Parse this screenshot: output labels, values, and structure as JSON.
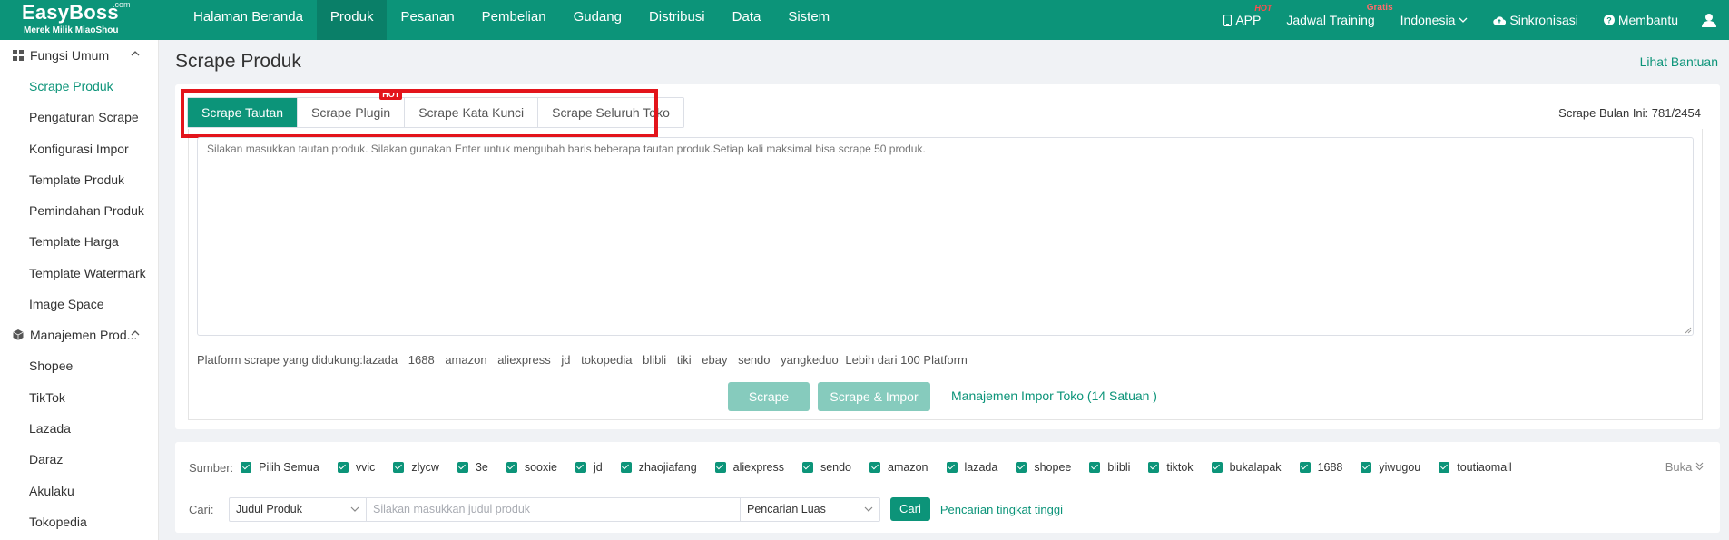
{
  "logo": {
    "brand": "EasyBoss",
    "com": ".com",
    "sub": "Merek Milik MiaoShou"
  },
  "nav": {
    "items": [
      "Halaman Beranda",
      "Produk",
      "Pesanan",
      "Pembelian",
      "Gudang",
      "Distribusi",
      "Data",
      "Sistem"
    ],
    "active": "Produk"
  },
  "tools": {
    "app": "APP",
    "app_badge": "HOT",
    "training": "Jadwal Training",
    "training_badge": "Gratis",
    "language": "Indonesia",
    "sync": "Sinkronisasi",
    "help": "Membantu"
  },
  "sidebar": {
    "group1": "Fungsi Umum",
    "group1_items": [
      "Scrape Produk",
      "Pengaturan Scrape",
      "Konfigurasi Impor",
      "Template Produk",
      "Pemindahan Produk",
      "Template Harga",
      "Template Watermark",
      "Image Space"
    ],
    "group2": "Manajemen Prod...",
    "group2_items": [
      "Shopee",
      "TikTok",
      "Lazada",
      "Daraz",
      "Akulaku",
      "Tokopedia"
    ]
  },
  "page": {
    "title": "Scrape Produk",
    "help_link": "Lihat Bantuan"
  },
  "tabs": {
    "items": [
      "Scrape Tautan",
      "Scrape Plugin",
      "Scrape Kata Kunci",
      "Scrape Seluruh Toko"
    ],
    "hot_badge": "HOT"
  },
  "scrape_count": "Scrape Bulan Ini:  781/2454",
  "textarea_placeholder": "Silakan masukkan tautan produk. Silakan gunakan Enter untuk mengubah baris beberapa tautan produk.Setiap kali maksimal bisa scrape 50 produk.",
  "platforms": {
    "label": "Platform scrape yang didukung:",
    "items": [
      "lazada",
      "1688",
      "amazon",
      "aliexpress",
      "jd",
      "tokopedia",
      "blibli",
      "tiki",
      "ebay",
      "sendo",
      "yangkeduo"
    ],
    "more": "Lebih dari 100 Platform"
  },
  "buttons": {
    "scrape": "Scrape",
    "scrape_import": "Scrape & Impor",
    "manage": "Manajemen Impor Toko (14 Satuan )"
  },
  "source": {
    "label": "Sumber:",
    "items": [
      "Pilih Semua",
      "vvic",
      "zlycw",
      "3e",
      "sooxie",
      "jd",
      "zhaojiafang",
      "aliexpress",
      "sendo",
      "amazon",
      "lazada",
      "shopee",
      "blibli",
      "tiktok",
      "bukalapak",
      "1688",
      "yiwugou",
      "toutiaomall"
    ],
    "expand": "Buka"
  },
  "search": {
    "label": "Cari:",
    "field": "Judul Produk",
    "placeholder": "Silakan masukkan judul produk",
    "mode": "Pencarian Luas",
    "button": "Cari",
    "advanced": "Pencarian tingkat tinggi"
  },
  "colors": {
    "brand": "#0c9479",
    "highlight": "#e3141b",
    "disabled_button": "#86cbbd"
  }
}
